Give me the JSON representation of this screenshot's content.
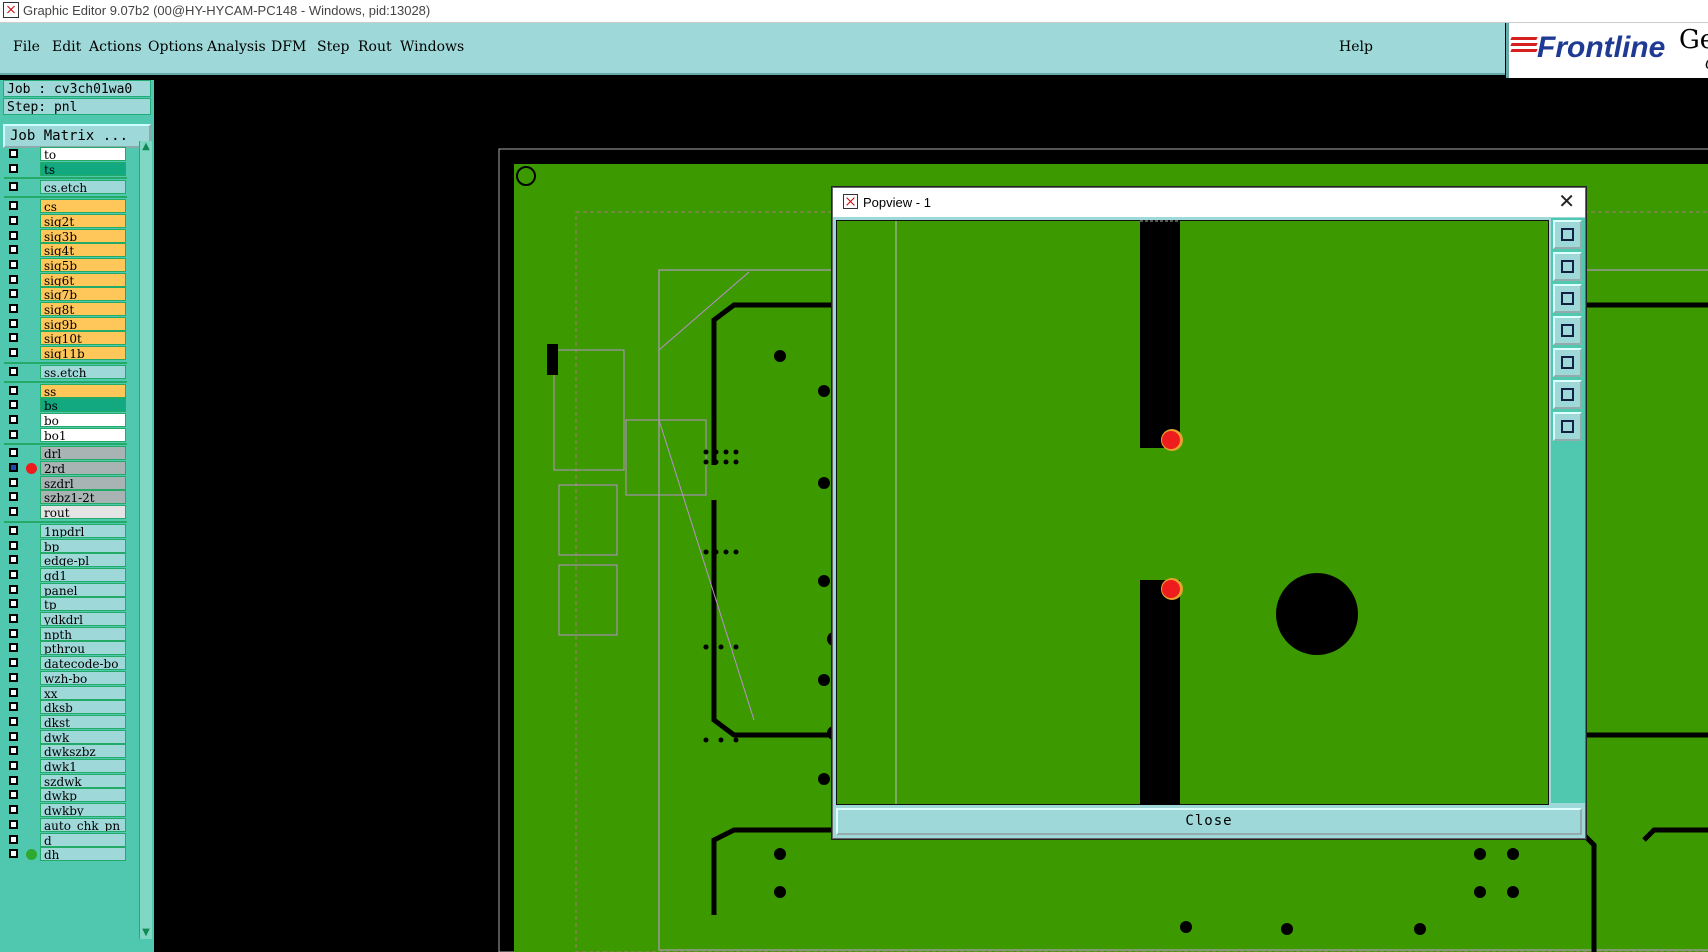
{
  "window": {
    "title": "Graphic Editor 9.07b2 (00@HY-HYCAM-PC148 - Windows, pid:13028)"
  },
  "menu": {
    "items": [
      "File",
      "Edit",
      "Actions",
      "Options",
      "Analysis",
      "DFM",
      "Step",
      "Rout",
      "Windows"
    ],
    "help": "Help"
  },
  "brand": {
    "logo": "Frontline",
    "gen": "Ger",
    "sub": "G"
  },
  "job": {
    "job_label": "Job : cv3ch01wa0",
    "step_label": "Step: pnl",
    "matrix_button": "Job Matrix ..."
  },
  "layers": [
    {
      "name": "to",
      "color": "#ffffff"
    },
    {
      "name": "ts",
      "color": "#12a880"
    },
    {
      "name": "cs.etch",
      "color": "#9ed8d8"
    },
    {
      "name": "cs",
      "color": "#ffc65a"
    },
    {
      "name": "sig2t",
      "color": "#ffc65a"
    },
    {
      "name": "sig3b",
      "color": "#ffc65a"
    },
    {
      "name": "sig4t",
      "color": "#ffc65a"
    },
    {
      "name": "sig5b",
      "color": "#ffc65a"
    },
    {
      "name": "sig6t",
      "color": "#ffc65a"
    },
    {
      "name": "sig7b",
      "color": "#ffc65a"
    },
    {
      "name": "sig8t",
      "color": "#ffc65a"
    },
    {
      "name": "sig9b",
      "color": "#ffc65a"
    },
    {
      "name": "sig10t",
      "color": "#ffc65a"
    },
    {
      "name": "sig11b",
      "color": "#ffc65a"
    },
    {
      "name": "ss.etch",
      "color": "#9ed8d8"
    },
    {
      "name": "ss",
      "color": "#ffc65a"
    },
    {
      "name": "bs",
      "color": "#12a880"
    },
    {
      "name": "bo",
      "color": "#ffffff"
    },
    {
      "name": "bo1",
      "color": "#ffffff"
    },
    {
      "name": "drl",
      "color": "#a8b4b4"
    },
    {
      "name": "2rd",
      "color": "#a8b4b4",
      "checked": true,
      "dot": "#ee1c1c"
    },
    {
      "name": "szdrl",
      "color": "#a8b4b4"
    },
    {
      "name": "szbz1-2t",
      "color": "#a8b4b4"
    },
    {
      "name": "rout",
      "color": "#e4e4e4"
    },
    {
      "name": "1npdrl",
      "color": "#9ed8d8"
    },
    {
      "name": "bp",
      "color": "#9ed8d8"
    },
    {
      "name": "edge-pl",
      "color": "#9ed8d8"
    },
    {
      "name": "gd1",
      "color": "#9ed8d8"
    },
    {
      "name": "panel",
      "color": "#9ed8d8"
    },
    {
      "name": "tp",
      "color": "#9ed8d8"
    },
    {
      "name": "ydkdrl",
      "color": "#9ed8d8"
    },
    {
      "name": "npth",
      "color": "#9ed8d8"
    },
    {
      "name": "pthrou",
      "color": "#9ed8d8"
    },
    {
      "name": "datecode-bo",
      "color": "#9ed8d8"
    },
    {
      "name": "wzh-bo",
      "color": "#9ed8d8"
    },
    {
      "name": "xx",
      "color": "#9ed8d8"
    },
    {
      "name": "dksb",
      "color": "#9ed8d8"
    },
    {
      "name": "dkst",
      "color": "#9ed8d8"
    },
    {
      "name": "dwk",
      "color": "#9ed8d8"
    },
    {
      "name": "dwkszbz",
      "color": "#9ed8d8"
    },
    {
      "name": "dwk1",
      "color": "#9ed8d8"
    },
    {
      "name": "szdwk",
      "color": "#9ed8d8"
    },
    {
      "name": "dwkp",
      "color": "#9ed8d8"
    },
    {
      "name": "dwkby",
      "color": "#9ed8d8"
    },
    {
      "name": "auto_chk_pn",
      "color": "#9ed8d8"
    },
    {
      "name": "d",
      "color": "#9ed8d8"
    },
    {
      "name": "dh",
      "color": "#9ed8d8",
      "dot": "#2fa82f"
    }
  ],
  "colors": {
    "board_green": "#3c9a00",
    "panel_teal": "#50c8b0",
    "menu_bg": "#9ed8d8",
    "highlight_red": "#ee1c1c"
  },
  "popview": {
    "title": "Popview - 1",
    "close_label": "Close",
    "tools": [
      "zoom-fit-icon",
      "pan-up-icon",
      "pan-down-icon",
      "pan-left-icon",
      "pan-right-icon",
      "zoom-in-icon",
      "zoom-out-icon"
    ]
  }
}
